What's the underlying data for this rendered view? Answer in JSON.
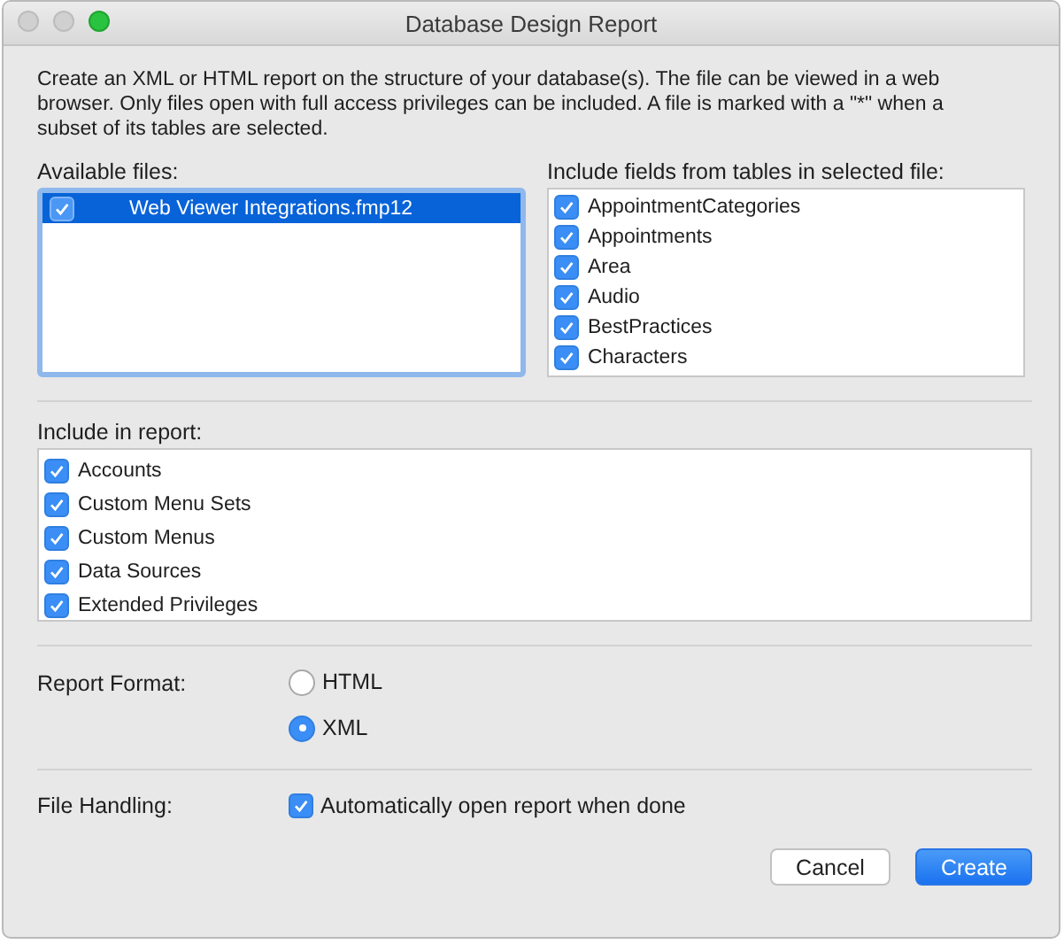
{
  "window": {
    "title": "Database Design Report"
  },
  "description": "Create an XML or HTML report on the structure of your database(s). The file can be viewed in a web browser. Only files open with full access privileges can be included. A file is marked with a \"*\" when a subset of its tables are selected.",
  "available_files": {
    "label": "Available files:",
    "items": [
      {
        "name": "Web Viewer Integrations.fmp12",
        "checked": true,
        "selected": true
      }
    ]
  },
  "tables": {
    "label": "Include fields from tables in selected file:",
    "items": [
      {
        "name": "AppointmentCategories",
        "checked": true
      },
      {
        "name": "Appointments",
        "checked": true
      },
      {
        "name": "Area",
        "checked": true
      },
      {
        "name": "Audio",
        "checked": true
      },
      {
        "name": "BestPractices",
        "checked": true
      },
      {
        "name": "Characters",
        "checked": true
      }
    ]
  },
  "include_in_report": {
    "label": "Include in report:",
    "items": [
      {
        "name": "Accounts",
        "checked": true
      },
      {
        "name": "Custom Menu Sets",
        "checked": true
      },
      {
        "name": "Custom Menus",
        "checked": true
      },
      {
        "name": "Data Sources",
        "checked": true
      },
      {
        "name": "Extended Privileges",
        "checked": true
      }
    ]
  },
  "report_format": {
    "label": "Report Format:",
    "options": [
      {
        "label": "HTML",
        "selected": false
      },
      {
        "label": "XML",
        "selected": true
      }
    ]
  },
  "file_handling": {
    "label": "File Handling:",
    "option": {
      "label": "Automatically open report when done",
      "checked": true
    }
  },
  "buttons": [
    {
      "label": "Cancel",
      "kind": "secondary"
    },
    {
      "label": "Create",
      "kind": "primary"
    }
  ]
}
